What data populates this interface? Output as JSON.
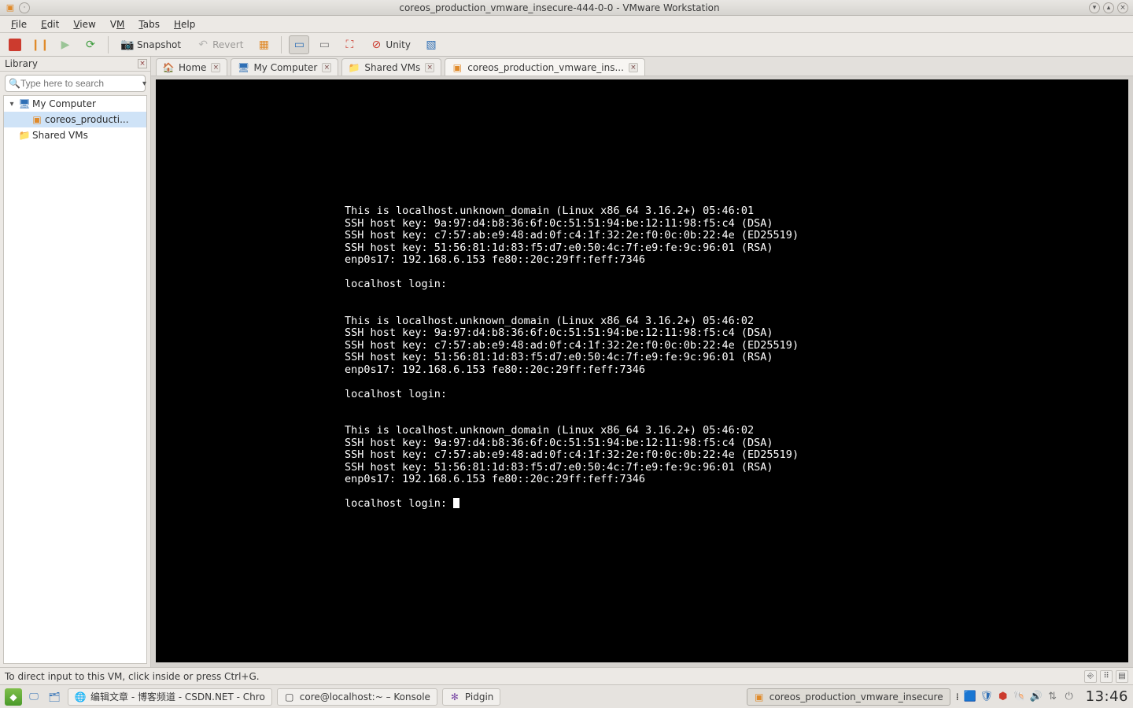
{
  "window": {
    "title": "coreos_production_vmware_insecure-444-0-0 - VMware Workstation"
  },
  "menubar": [
    {
      "label": "File",
      "u": 0
    },
    {
      "label": "Edit",
      "u": 0
    },
    {
      "label": "View",
      "u": 0
    },
    {
      "label": "VM",
      "u": 1
    },
    {
      "label": "Tabs",
      "u": 0
    },
    {
      "label": "Help",
      "u": 0
    }
  ],
  "toolbar": {
    "snapshot_label": "Snapshot",
    "revert_label": "Revert",
    "unity_label": "Unity"
  },
  "sidebar": {
    "title": "Library",
    "search_placeholder": "Type here to search",
    "tree": {
      "root_label": "My Computer",
      "vm_label": "coreos_producti...",
      "shared_label": "Shared VMs"
    }
  },
  "tabs": [
    {
      "icon": "home-icon",
      "label": "Home"
    },
    {
      "icon": "monitor-icon",
      "label": "My Computer"
    },
    {
      "icon": "folder-icon",
      "label": "Shared VMs"
    },
    {
      "icon": "vm-icon",
      "label": "coreos_production_vmware_ins..."
    }
  ],
  "console_lines": [
    "This is localhost.unknown_domain (Linux x86_64 3.16.2+) 05:46:01",
    "SSH host key: 9a:97:d4:b8:36:6f:0c:51:51:94:be:12:11:98:f5:c4 (DSA)",
    "SSH host key: c7:57:ab:e9:48:ad:0f:c4:1f:32:2e:f0:0c:0b:22:4e (ED25519)",
    "SSH host key: 51:56:81:1d:83:f5:d7:e0:50:4c:7f:e9:fe:9c:96:01 (RSA)",
    "enp0s17: 192.168.6.153 fe80::20c:29ff:feff:7346",
    "",
    "localhost login:",
    "",
    "",
    "This is localhost.unknown_domain (Linux x86_64 3.16.2+) 05:46:02",
    "SSH host key: 9a:97:d4:b8:36:6f:0c:51:51:94:be:12:11:98:f5:c4 (DSA)",
    "SSH host key: c7:57:ab:e9:48:ad:0f:c4:1f:32:2e:f0:0c:0b:22:4e (ED25519)",
    "SSH host key: 51:56:81:1d:83:f5:d7:e0:50:4c:7f:e9:fe:9c:96:01 (RSA)",
    "enp0s17: 192.168.6.153 fe80::20c:29ff:feff:7346",
    "",
    "localhost login:",
    "",
    "",
    "This is localhost.unknown_domain (Linux x86_64 3.16.2+) 05:46:02",
    "SSH host key: 9a:97:d4:b8:36:6f:0c:51:51:94:be:12:11:98:f5:c4 (DSA)",
    "SSH host key: c7:57:ab:e9:48:ad:0f:c4:1f:32:2e:f0:0c:0b:22:4e (ED25519)",
    "SSH host key: 51:56:81:1d:83:f5:d7:e0:50:4c:7f:e9:fe:9c:96:01 (RSA)",
    "enp0s17: 192.168.6.153 fe80::20c:29ff:feff:7346",
    "",
    "localhost login: "
  ],
  "statusbar": {
    "hint": "To direct input to this VM, click inside or press Ctrl+G."
  },
  "taskbar": {
    "items": [
      {
        "icon": "chrome-icon",
        "label": "编辑文章 - 博客频道 - CSDN.NET - Chro"
      },
      {
        "icon": "konsole-icon",
        "label": "core@localhost:~ – Konsole"
      },
      {
        "icon": "pidgin-icon",
        "label": "Pidgin"
      },
      {
        "icon": "vmware-icon",
        "label": "coreos_production_vmware_insecure"
      }
    ],
    "clock": "13:46"
  }
}
